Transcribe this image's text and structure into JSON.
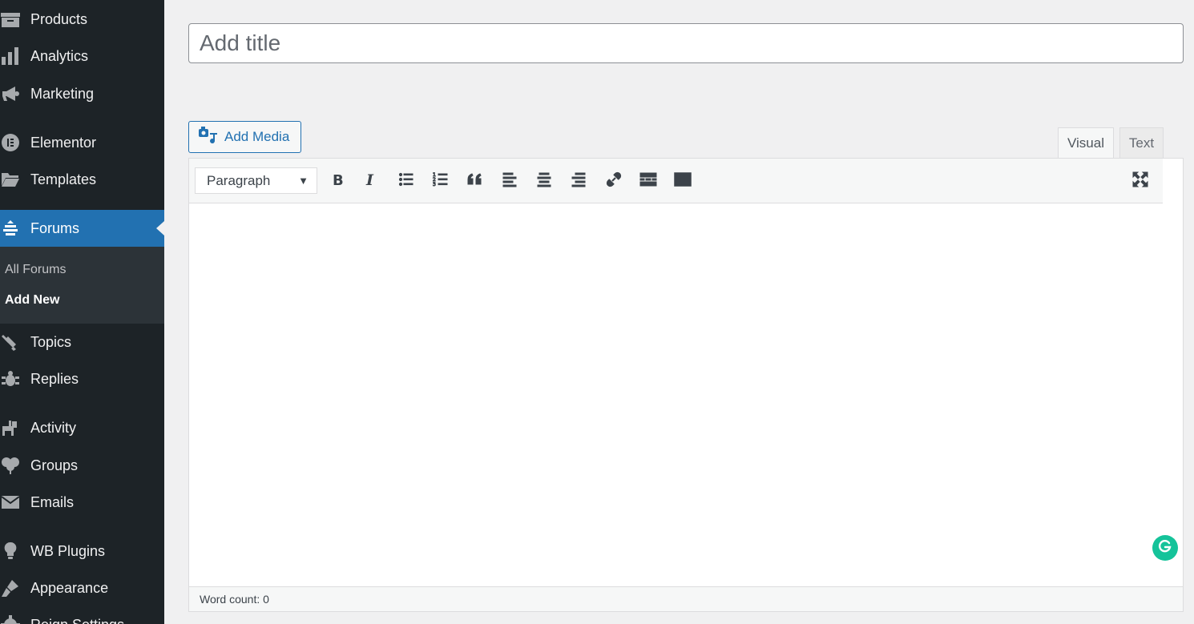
{
  "sidebar": {
    "items": [
      {
        "label": "Products",
        "icon": "archive-icon"
      },
      {
        "label": "Analytics",
        "icon": "bar-chart-icon"
      },
      {
        "label": "Marketing",
        "icon": "megaphone-icon"
      },
      {
        "label": "Elementor",
        "icon": "elementor-icon"
      },
      {
        "label": "Templates",
        "icon": "folder-icon"
      },
      {
        "label": "Forums",
        "icon": "forums-icon",
        "current": true
      },
      {
        "label": "Topics",
        "icon": "topics-icon"
      },
      {
        "label": "Replies",
        "icon": "replies-icon"
      },
      {
        "label": "Activity",
        "icon": "activity-icon"
      },
      {
        "label": "Groups",
        "icon": "groups-icon"
      },
      {
        "label": "Emails",
        "icon": "envelope-icon"
      },
      {
        "label": "WB Plugins",
        "icon": "lightbulb-icon"
      },
      {
        "label": "Appearance",
        "icon": "paintbrush-icon"
      },
      {
        "label": "Reign Settings",
        "icon": "gear-icon"
      }
    ],
    "submenu": [
      {
        "label": "All Forums"
      },
      {
        "label": "Add New",
        "active": true
      }
    ]
  },
  "editor": {
    "title_placeholder": "Add title",
    "title_value": "",
    "add_media_label": "Add Media",
    "tabs": [
      {
        "label": "Visual",
        "active": true
      },
      {
        "label": "Text"
      }
    ],
    "format_select": "Paragraph",
    "word_count": "Word count: 0"
  },
  "colors": {
    "sidebar_bg": "#1d2327",
    "accent": "#2271b1",
    "grammarly": "#15c39a"
  }
}
